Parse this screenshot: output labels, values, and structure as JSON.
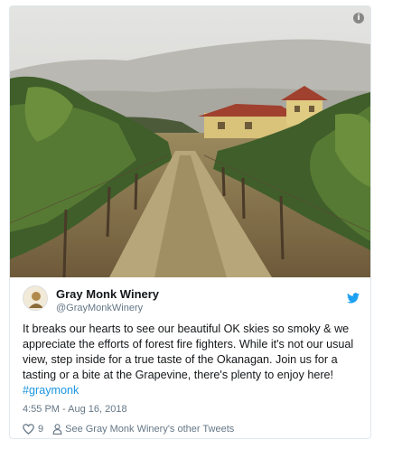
{
  "tweet": {
    "display_name": "Gray Monk Winery",
    "handle": "@GrayMonkWinery",
    "text_main": "It breaks our hearts to see our beautiful OK skies so smoky & we appreciate the efforts of forest fire fighters. While it's not our usual view, step inside for a true taste of the Okanagan. Join us for a tasting or a bite at the Grapevine, there's plenty to enjoy here! ",
    "hashtag": "#graymonk",
    "timestamp": "4:55 PM - Aug 16, 2018",
    "like_count": "9",
    "other_tweets_link": "See Gray Monk Winery's other Tweets",
    "info_glyph": "i"
  },
  "media": {
    "description_icon": "photo-icon"
  },
  "colors": {
    "link": "#1b95e0",
    "text": "#14171a",
    "muted": "#657786",
    "border": "#e1e8ed"
  }
}
